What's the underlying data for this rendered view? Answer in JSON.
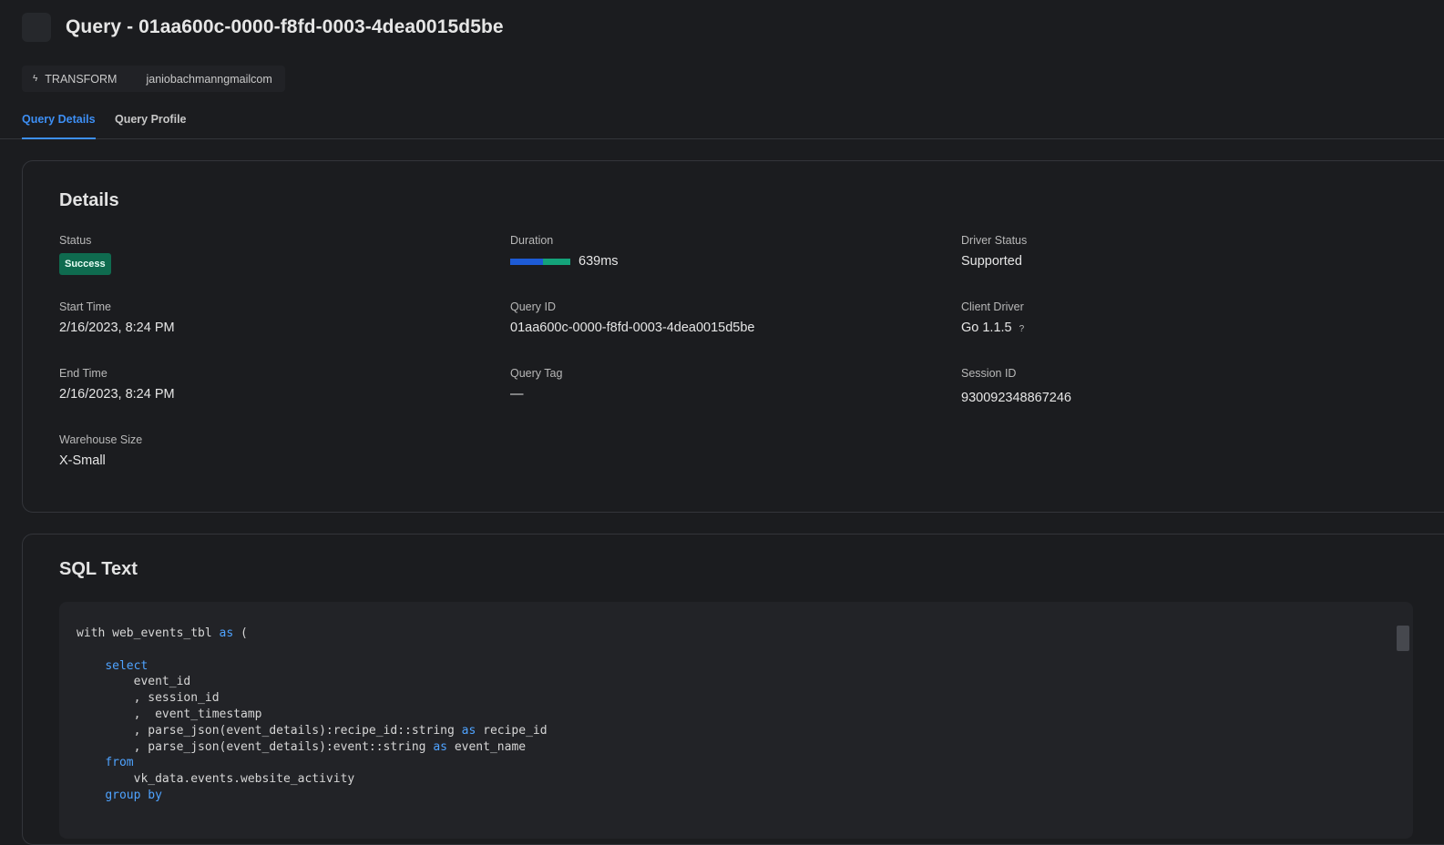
{
  "header": {
    "title": "Query - 01aa600c-0000-f8fd-0003-4dea0015d5be"
  },
  "chips": {
    "type_label": "TRANSFORM",
    "user": "janiobachmanngmailcom"
  },
  "tabs": [
    {
      "label": "Query Details",
      "active": true
    },
    {
      "label": "Query Profile",
      "active": false
    }
  ],
  "details": {
    "title": "Details",
    "status": {
      "label": "Status",
      "value": "Success"
    },
    "duration": {
      "label": "Duration",
      "value": "639ms",
      "split_fraction": 0.54
    },
    "driver_status": {
      "label": "Driver Status",
      "value": "Supported"
    },
    "start_time": {
      "label": "Start Time",
      "value": "2/16/2023, 8:24 PM"
    },
    "query_id": {
      "label": "Query ID",
      "value": "01aa600c-0000-f8fd-0003-4dea0015d5be"
    },
    "client_driver": {
      "label": "Client Driver",
      "value": "Go 1.1.5",
      "help": "?"
    },
    "end_time": {
      "label": "End Time",
      "value": "2/16/2023, 8:24 PM"
    },
    "query_tag": {
      "label": "Query Tag",
      "value": "—"
    },
    "session_id": {
      "label": "Session ID",
      "value": "930092348867246"
    },
    "warehouse_size": {
      "label": "Warehouse Size",
      "value": "X-Small"
    }
  },
  "sql": {
    "title": "SQL Text",
    "lines": [
      [
        {
          "t": "with web_events_tbl "
        },
        {
          "t": "as",
          "kw": true
        },
        {
          "t": " ("
        }
      ],
      [
        {
          "t": ""
        }
      ],
      [
        {
          "t": "    "
        },
        {
          "t": "select",
          "kw": true
        }
      ],
      [
        {
          "t": "        event_id"
        }
      ],
      [
        {
          "t": "        , session_id"
        }
      ],
      [
        {
          "t": "        ,  event_timestamp"
        }
      ],
      [
        {
          "t": "        , parse_json(event_details):recipe_id::string "
        },
        {
          "t": "as",
          "kw": true
        },
        {
          "t": " recipe_id"
        }
      ],
      [
        {
          "t": "        , parse_json(event_details):event::string "
        },
        {
          "t": "as",
          "kw": true
        },
        {
          "t": " event_name"
        }
      ],
      [
        {
          "t": "    "
        },
        {
          "t": "from",
          "kw": true
        }
      ],
      [
        {
          "t": "        vk_data.events.website_activity"
        }
      ],
      [
        {
          "t": "    "
        },
        {
          "t": "group by",
          "kw": true
        }
      ]
    ]
  },
  "colors": {
    "accent": "#3d8ff5",
    "success": "#0f6b4f",
    "keyword": "#4fa3ff"
  }
}
